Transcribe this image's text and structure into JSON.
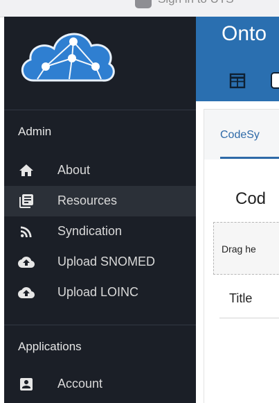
{
  "browser": {
    "signin_text": "Sign in to UTS"
  },
  "sidebar": {
    "sections": [
      {
        "title": "Admin",
        "items": [
          {
            "label": "About",
            "icon": "home-icon"
          },
          {
            "label": "Resources",
            "icon": "library-icon",
            "active": true
          },
          {
            "label": "Syndication",
            "icon": "rss-icon"
          },
          {
            "label": "Upload SNOMED",
            "icon": "cloud-upload-icon"
          },
          {
            "label": "Upload LOINC",
            "icon": "cloud-upload-icon"
          }
        ]
      },
      {
        "title": "Applications",
        "items": [
          {
            "label": "Account",
            "icon": "account-box-icon"
          }
        ]
      }
    ]
  },
  "header": {
    "title": "Onto"
  },
  "tabs": [
    {
      "label": "CodeSy",
      "active": true
    }
  ],
  "main": {
    "heading": "Cod",
    "dropzone_text": "Drag he",
    "table": {
      "columns": [
        "Title"
      ]
    }
  },
  "colors": {
    "sidebar_bg": "#1b1f27",
    "sidebar_active": "#2b3038",
    "header_bg": "#2a6fb0",
    "tab_accent": "#2e6aa8",
    "logo_blue": "#2f7fd1"
  }
}
